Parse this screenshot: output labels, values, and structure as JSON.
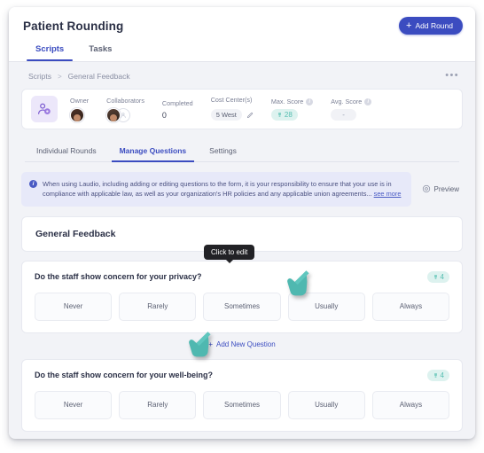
{
  "header": {
    "title": "Patient Rounding",
    "add_round_label": "Add Round",
    "add_round_plus": "+",
    "add_round_color": "#3b4cc0",
    "tabs": [
      {
        "label": "Scripts",
        "active": true
      },
      {
        "label": "Tasks",
        "active": false
      }
    ]
  },
  "breadcrumb": {
    "items": [
      "Scripts",
      "General Feedback"
    ],
    "separator": ">",
    "overflow_menu": "•••"
  },
  "meta": {
    "avatar_icon": "user-badge-icon",
    "fields": [
      {
        "label": "Owner",
        "type": "avatar",
        "value": ""
      },
      {
        "label": "Collaborators",
        "type": "avatar-group",
        "value": ""
      },
      {
        "label": "Completed",
        "type": "text",
        "value": "0"
      },
      {
        "label": "Cost Center(s)",
        "type": "pill-edit",
        "value": "5 West"
      },
      {
        "label": "Max. Score",
        "type": "pill-teal",
        "value": "28",
        "has_info": true
      },
      {
        "label": "Avg. Score",
        "type": "pill-dot",
        "value": "-",
        "has_info": true
      }
    ]
  },
  "section_tabs": [
    {
      "label": "Individual Rounds",
      "active": false
    },
    {
      "label": "Manage Questions",
      "active": true
    },
    {
      "label": "Settings",
      "active": false
    }
  ],
  "banner": {
    "icon": "info-icon",
    "text": "When using Laudio, including adding or editing questions to the form, it is your responsibility to ensure that your use is in compliance with applicable law, as well as your organization's HR policies and any applicable union agreements...",
    "see_more": "see more",
    "preview_label": "Preview",
    "preview_icon": "eye-icon",
    "accent_color": "#4a5bc4"
  },
  "general_feedback": {
    "title": "General Feedback",
    "tooltip": "Click to edit"
  },
  "questions": [
    {
      "text": "Do the staff show concern for your privacy?",
      "score": "4",
      "score_icon": "award-icon",
      "options": [
        "Never",
        "Rarely",
        "Sometimes",
        "Usually",
        "Always"
      ]
    },
    {
      "text": "Do the staff show concern for your well-being?",
      "score": "4",
      "score_icon": "award-icon",
      "options": [
        "Never",
        "Rarely",
        "Sometimes",
        "Usually",
        "Always"
      ]
    }
  ],
  "add_question": {
    "label": "Add New Question",
    "plus": "+"
  },
  "cursors": [
    {
      "name": "hand-cursor-usually",
      "color": "#4fb8b0"
    },
    {
      "name": "hand-cursor-add-question",
      "color": "#4fb8b0"
    }
  ]
}
